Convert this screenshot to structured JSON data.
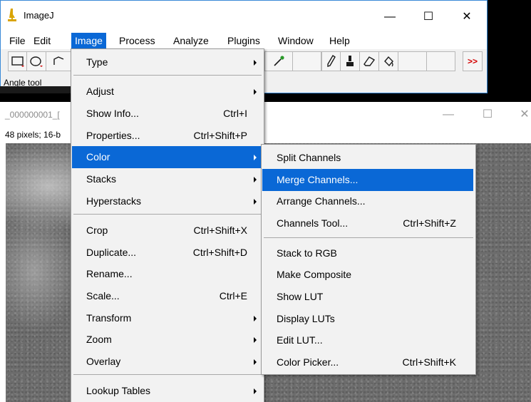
{
  "app": {
    "title": "ImageJ",
    "minimize_glyph": "—",
    "maximize_glyph": "☐",
    "close_glyph": "✕"
  },
  "menubar": {
    "items": [
      "File",
      "Edit",
      "Image",
      "Process",
      "Analyze",
      "Plugins",
      "Window",
      "Help"
    ],
    "active": "Image"
  },
  "toolbar": {
    "tools": [
      "rectangle-tool",
      "oval-tool",
      "polygon-tool",
      "dropper-tool",
      "pencil-tool",
      "brush-tool",
      "eraser-tool",
      "flood-fill-tool",
      "more-tools"
    ],
    "more_label": ">>",
    "accent_color": "#d40000"
  },
  "status": {
    "text": "Angle tool"
  },
  "image_window": {
    "title": "_000000001_[",
    "info": "48 pixels; 16-b",
    "minimize_glyph": "—",
    "maximize_glyph": "☐",
    "close_glyph": "✕"
  },
  "image_menu": {
    "items": [
      {
        "label": "Type",
        "shortcut": "",
        "submenu": true
      },
      {
        "label": "Adjust",
        "shortcut": "",
        "submenu": true
      },
      {
        "label": "Show Info...",
        "shortcut": "Ctrl+I",
        "submenu": false
      },
      {
        "label": "Properties...",
        "shortcut": "Ctrl+Shift+P",
        "submenu": false
      },
      {
        "label": "Color",
        "shortcut": "",
        "submenu": true
      },
      {
        "label": "Stacks",
        "shortcut": "",
        "submenu": true
      },
      {
        "label": "Hyperstacks",
        "shortcut": "",
        "submenu": true
      },
      {
        "label": "Crop",
        "shortcut": "Ctrl+Shift+X",
        "submenu": false
      },
      {
        "label": "Duplicate...",
        "shortcut": "Ctrl+Shift+D",
        "submenu": false
      },
      {
        "label": "Rename...",
        "shortcut": "",
        "submenu": false
      },
      {
        "label": "Scale...",
        "shortcut": "Ctrl+E",
        "submenu": false
      },
      {
        "label": "Transform",
        "shortcut": "",
        "submenu": true
      },
      {
        "label": "Zoom",
        "shortcut": "",
        "submenu": true
      },
      {
        "label": "Overlay",
        "shortcut": "",
        "submenu": true
      },
      {
        "label": "Lookup Tables",
        "shortcut": "",
        "submenu": true
      }
    ],
    "highlighted": "Color"
  },
  "color_menu": {
    "items": [
      {
        "label": "Split Channels",
        "shortcut": ""
      },
      {
        "label": "Merge Channels...",
        "shortcut": ""
      },
      {
        "label": "Arrange Channels...",
        "shortcut": ""
      },
      {
        "label": "Channels Tool...",
        "shortcut": "Ctrl+Shift+Z"
      },
      {
        "label": "Stack to RGB",
        "shortcut": ""
      },
      {
        "label": "Make Composite",
        "shortcut": ""
      },
      {
        "label": "Show LUT",
        "shortcut": ""
      },
      {
        "label": "Display LUTs",
        "shortcut": ""
      },
      {
        "label": "Edit LUT...",
        "shortcut": ""
      },
      {
        "label": "Color Picker...",
        "shortcut": "Ctrl+Shift+K"
      }
    ],
    "highlighted": "Merge Channels..."
  }
}
